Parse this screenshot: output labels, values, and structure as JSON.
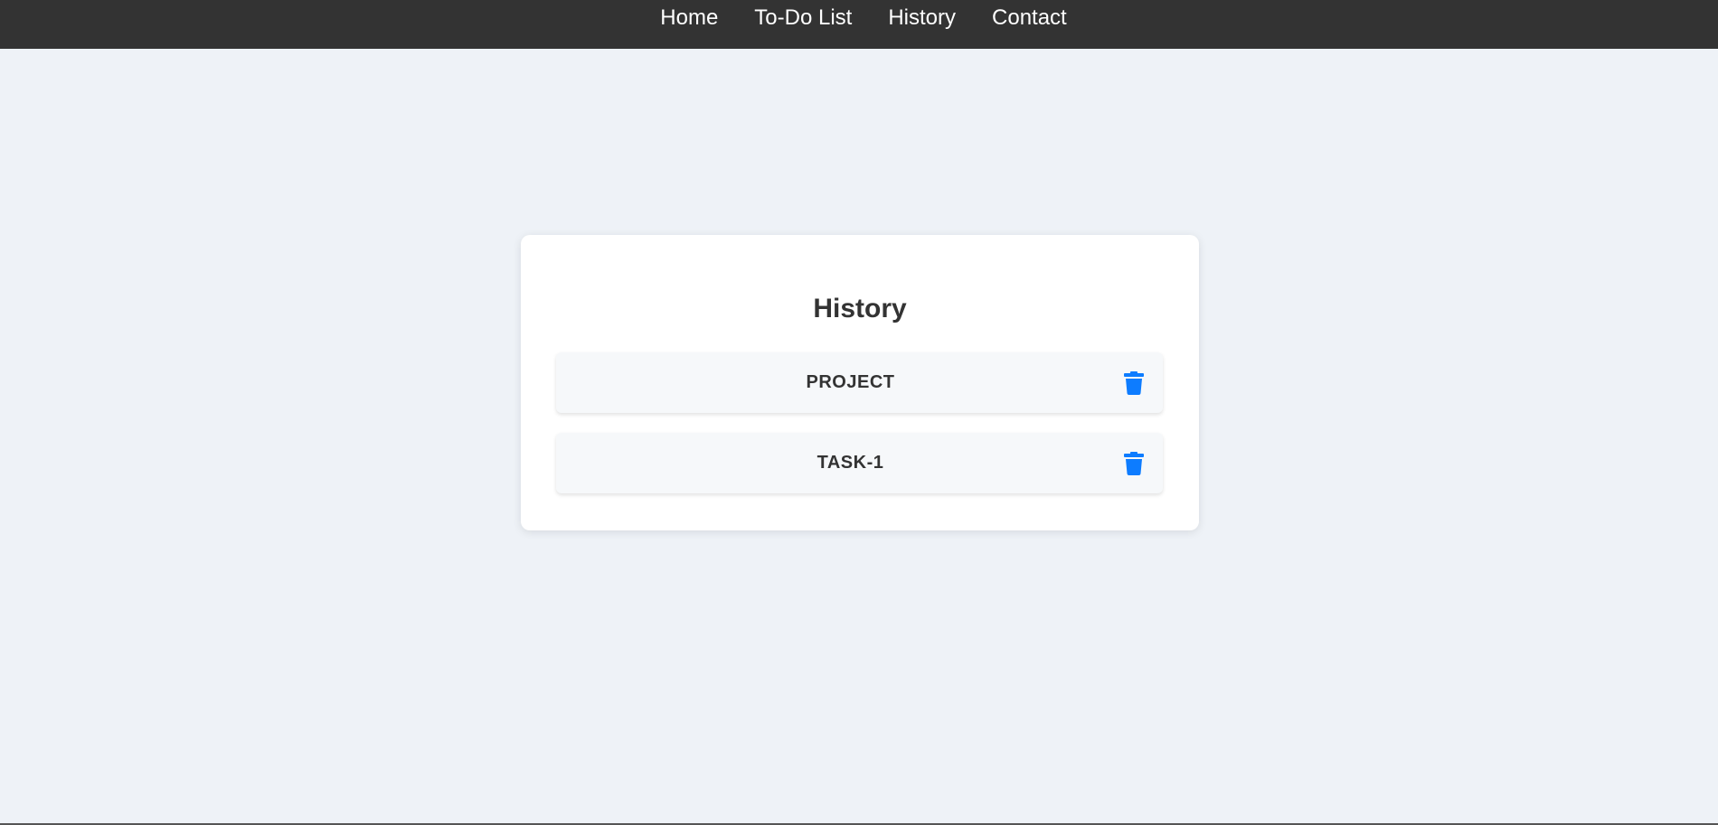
{
  "nav": {
    "links": [
      "Home",
      "To-Do List",
      "History",
      "Contact"
    ]
  },
  "history": {
    "title": "History",
    "items": [
      {
        "label": "PROJECT",
        "action_icon": "trash-icon"
      },
      {
        "label": "TASK-1",
        "action_icon": "trash-icon"
      }
    ]
  },
  "colors": {
    "navbar_bg": "#333333",
    "page_bg": "#eef2f7",
    "card_bg": "#ffffff",
    "item_bg": "#f6f8fa",
    "accent": "#0d7cff",
    "text": "#333333"
  }
}
